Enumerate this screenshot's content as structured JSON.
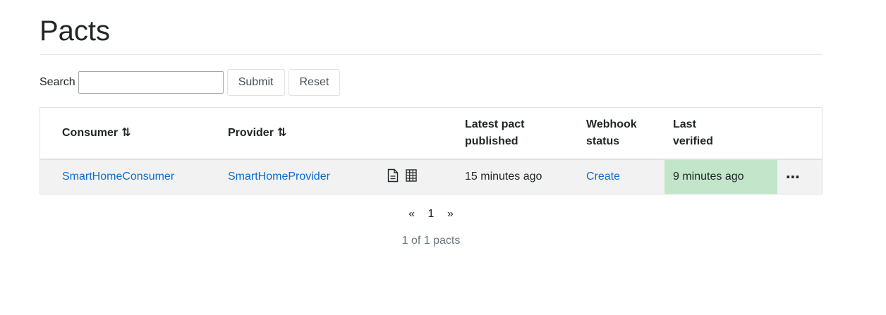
{
  "page": {
    "title": "Pacts"
  },
  "search": {
    "label": "Search",
    "value": "",
    "submit_label": "Submit",
    "reset_label": "Reset"
  },
  "table": {
    "headers": {
      "consumer": "Consumer",
      "provider": "Provider",
      "latest_line1": "Latest pact",
      "latest_line2": "published",
      "webhook_line1": "Webhook",
      "webhook_line2": "status",
      "verified_line1": "Last",
      "verified_line2": "verified"
    },
    "rows": [
      {
        "consumer": "SmartHomeConsumer",
        "provider": "SmartHomeProvider",
        "latest_pact_published": "15 minutes ago",
        "webhook_status": "Create",
        "last_verified": "9 minutes ago",
        "last_verified_color": "#c3e6cb",
        "icons": [
          "document-icon",
          "matrix-icon"
        ],
        "menu_label": "⋯"
      }
    ]
  },
  "pagination": {
    "prev": "«",
    "page": "1",
    "next": "»"
  },
  "summary": "1 of 1 pacts",
  "colors": {
    "link": "#0a6ed1",
    "row_bg": "#f2f2f2",
    "success_bg": "#c3e6cb"
  }
}
